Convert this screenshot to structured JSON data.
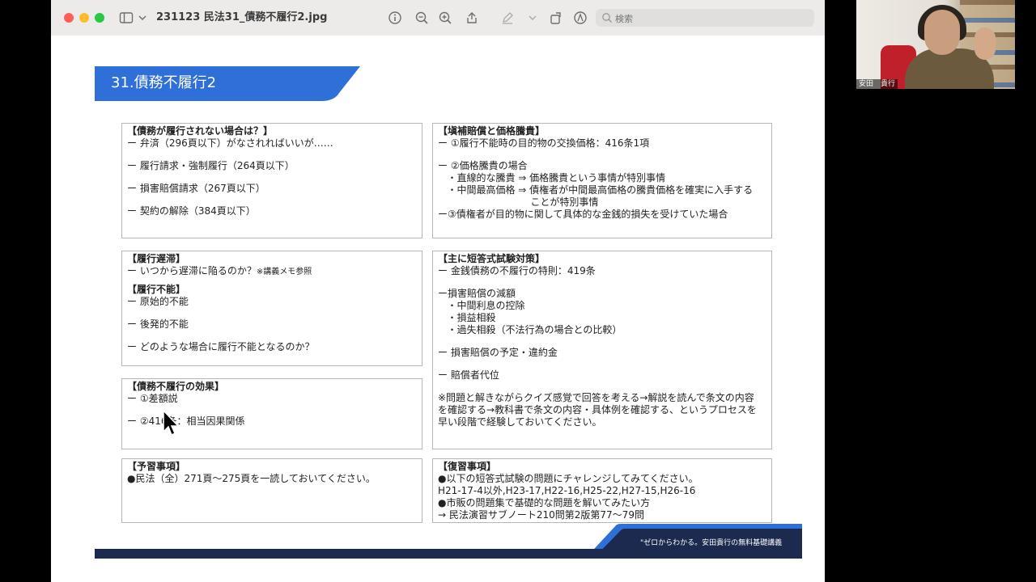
{
  "window": {
    "title": "231123 民法31_債務不履行2.jpg",
    "search_placeholder": "検索"
  },
  "slide": {
    "heading": "31.債務不履行2",
    "boxes": [
      {
        "id": "box-non-performance",
        "lines": [
          {
            "t": "【債務が履行されない場合は？】",
            "h": true
          },
          {
            "t": "ー 弁済（296頁以下）がなされればいいが……"
          },
          {
            "t": "",
            "gap": true
          },
          {
            "t": "ー 履行請求・強制履行（264頁以下）"
          },
          {
            "t": "",
            "gap": true
          },
          {
            "t": "ー 損害賠償請求（267頁以下）"
          },
          {
            "t": "",
            "gap": true
          },
          {
            "t": "ー 契約の解除（384頁以下）"
          }
        ]
      },
      {
        "id": "box-compensation",
        "lines": [
          {
            "t": "【塡補賠償と価格騰貴】",
            "h": true
          },
          {
            "t": "ー ①履行不能時の目的物の交換価格：416条1項"
          },
          {
            "t": "",
            "gap": true
          },
          {
            "t": "ー ②価格騰貴の場合"
          },
          {
            "t": "   ・直線的な騰貴 ⇒ 価格騰貴という事情が特別事情"
          },
          {
            "t": "   ・中間最高価格 ⇒ 債権者が中間最高価格の騰貴価格を確実に入手する"
          },
          {
            "t": "                              ことが特別事情"
          },
          {
            "t": "ー③債権者が目的物に関して具体的な金銭的損失を受けていた場合"
          }
        ]
      },
      {
        "id": "box-delay",
        "lines": [
          {
            "t": "【履行遅滞】",
            "h": true
          },
          {
            "t": "ー いつから遅滞に陥るのか？",
            "note": "※講義メモ参照"
          },
          {
            "t": "",
            "gapSmall": true
          },
          {
            "t": "【履行不能】",
            "h": true
          },
          {
            "t": "ー 原始的不能"
          },
          {
            "t": "",
            "gap": true
          },
          {
            "t": "ー 後発的不能"
          },
          {
            "t": "",
            "gap": true
          },
          {
            "t": "ー どのような場合に履行不能となるのか？"
          }
        ]
      },
      {
        "id": "box-short-answer",
        "lines": [
          {
            "t": "【主に短答式試験対策】",
            "h": true
          },
          {
            "t": "ー 金銭債務の不履行の特則：419条"
          },
          {
            "t": "",
            "gap": true
          },
          {
            "t": "ー損害賠償の減額"
          },
          {
            "t": "   ・中間利息の控除"
          },
          {
            "t": "   ・損益相殺"
          },
          {
            "t": "   ・過失相殺（不法行為の場合との比較）"
          },
          {
            "t": "",
            "gap": true
          },
          {
            "t": "ー 損害賠償の予定・違約金"
          },
          {
            "t": "",
            "gap": true
          },
          {
            "t": "ー 賠償者代位"
          },
          {
            "t": "",
            "gap": true
          },
          {
            "t": "※問題と解きながらクイズ感覚で回答を考える→解説を読んで条文の内容"
          },
          {
            "t": "を確認する→教科書で条文の内容・具体例を確認する、というプロセスを"
          },
          {
            "t": "早い段階で経験しておいてください。"
          }
        ]
      },
      {
        "id": "box-effect",
        "lines": [
          {
            "t": "【債務不履行の効果】",
            "h": true
          },
          {
            "t": "ー ①差額説"
          },
          {
            "t": "",
            "gap": true
          },
          {
            "t": "ー ②416条：相当因果関係"
          }
        ]
      },
      {
        "id": "box-preparation",
        "lines": [
          {
            "t": "【予習事項】",
            "h": true
          },
          {
            "t": "●民法（全）271頁〜275頁を一読しておいてください。"
          }
        ]
      },
      {
        "id": "box-review",
        "lines": [
          {
            "t": "【復習事項】",
            "h": true
          },
          {
            "t": "●以下の短答式試験の問題にチャレンジしてみてください。"
          },
          {
            "t": "H21-17-4以外,H23-17,H22-16,H25-22,H27-15,H26-16"
          },
          {
            "t": "●市販の問題集で基礎的な問題を解いてみたい方"
          },
          {
            "t": "→ 民法演習サブノート210問第2版第77〜79問"
          }
        ]
      }
    ],
    "footer": "\"ゼロからわかる。安田貴行の無料基礎講義",
    "brand_color": "#2f6fd8",
    "footer_color": "#1b2a4e"
  },
  "video": {
    "name_label": "安田　貴行"
  }
}
